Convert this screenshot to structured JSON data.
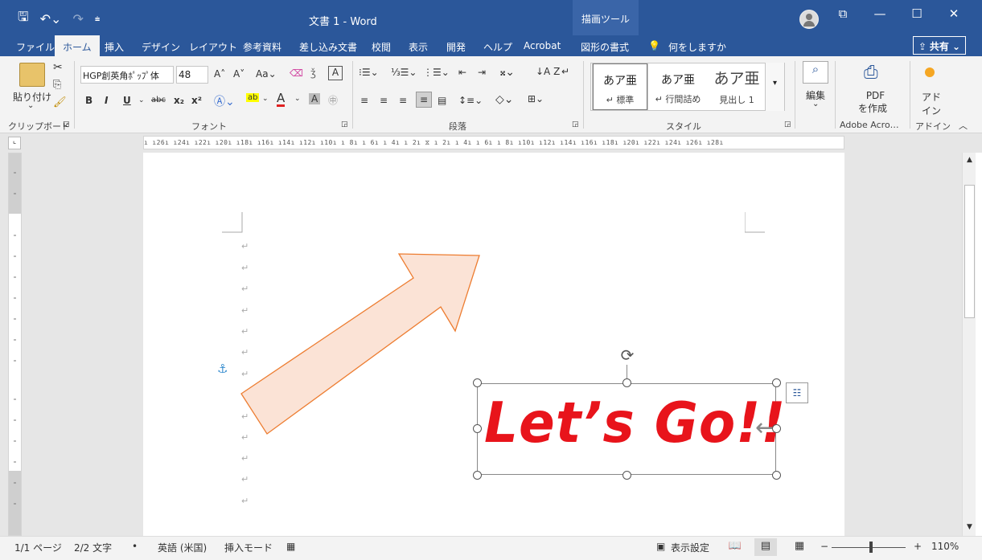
{
  "titlebar": {
    "title": "文書 1  -  Word",
    "context_tab": "描画ツール",
    "qat": {
      "save": "🖫",
      "undo": "↶⌄",
      "redo": "↷",
      "customize": "⩧"
    },
    "win": {
      "ribbon_display": "⧉",
      "minimize": "—",
      "maximize": "☐",
      "close": "✕"
    }
  },
  "tabs": {
    "file": "ファイル",
    "home": "ホーム",
    "insert": "挿入",
    "design": "デザイン",
    "layout": "レイアウト",
    "references": "参考資料",
    "mailings": "差し込み文書",
    "review": "校閲",
    "view": "表示",
    "developer": "開発",
    "help": "ヘルプ",
    "acrobat": "Acrobat",
    "shape_format": "図形の書式",
    "tell_me": "何をしますか",
    "share": "共有 ⌄"
  },
  "ribbon": {
    "clipboard": {
      "paste": "貼り付け",
      "paste_arrow": "⌄",
      "label": "クリップボード"
    },
    "font": {
      "name": "HGP創英角ﾎﾟｯﾌﾟ体",
      "size": "48",
      "grow": "A˄",
      "shrink": "A˅",
      "case": "Aa⌄",
      "bold": "B",
      "italic": "I",
      "underline": "U",
      "strike": "abc",
      "sub": "x₂",
      "sup": "x²",
      "label": "フォント"
    },
    "paragraph": {
      "label": "段落"
    },
    "styles": {
      "items": [
        {
          "sample": "あア亜",
          "name": "↵ 標準"
        },
        {
          "sample": "あア亜",
          "name": "↵ 行間詰め"
        },
        {
          "sample": "あア亜",
          "name": "見出し 1"
        }
      ],
      "label": "スタイル"
    },
    "editing": {
      "label": "編集",
      "arrow": "⌄"
    },
    "adobe": {
      "create_pdf_1": "PDF",
      "create_pdf_2": "を作成",
      "label": "Adobe Acro…"
    },
    "addins": {
      "addin_1": "アド",
      "addin_2": "イン",
      "label": "アドイン"
    }
  },
  "ruler": {
    "horizontal": "ı  ı26ı  ı24ı  ı22ı  ı20ı  ı18ı  ı16ı  ı14ı  ı12ı  ı10ı  ı 8ı  ı 6ı  ı 4ı  ı 2ı   ⧖   ı 2ı  ı 4ı  ı 6ı  ı 8ı  ı10ı  ı12ı  ı14ı  ı16ı  ı18ı  ı20ı  ı22ı  ı24ı  ı26ı  ı28ı"
  },
  "document": {
    "textbox_text": "Let’s Go!!",
    "paragraph_mark": "↵",
    "anchor": "⚓"
  },
  "statusbar": {
    "page": "1/1 ページ",
    "words": "2/2 文字",
    "dot": "•",
    "language": "英語 (米国)",
    "mode": "挿入モード",
    "display_settings": "表示設定",
    "zoom_minus": "−",
    "zoom_plus": "+",
    "zoom": "110%"
  },
  "colors": {
    "brand": "#2b579a",
    "arrow_fill": "#fbe3d6",
    "arrow_stroke": "#ed7d31",
    "text_red": "#e8141b"
  }
}
